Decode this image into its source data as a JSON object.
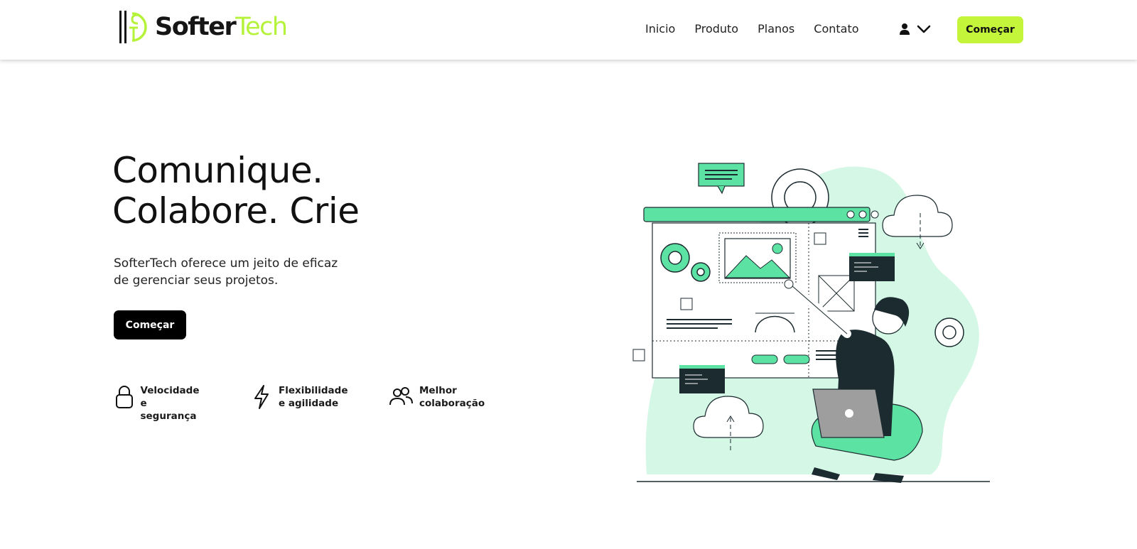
{
  "brand": {
    "name_part1": "Softer",
    "name_part2": "Tech",
    "accent_color": "#b5f23a",
    "illustration_green": "#5ce3a4"
  },
  "nav": {
    "items": [
      {
        "label": "Inicio"
      },
      {
        "label": "Produto"
      },
      {
        "label": "Planos"
      },
      {
        "label": "Contato"
      }
    ],
    "user_icon": "user-icon",
    "dropdown_icon": "chevron-down-icon",
    "cta_label": "Começar"
  },
  "hero": {
    "title_line1": "Comunique.",
    "title_line2": "Colabore. Crie",
    "subtitle_line1": "SofterTech oferece um jeito de eficaz",
    "subtitle_line2": "de gerenciar seus projetos.",
    "cta_label": "Começar"
  },
  "features": [
    {
      "icon": "lock-icon",
      "line1": "Velocidade",
      "line2": "e segurança"
    },
    {
      "icon": "lightning-icon",
      "line1": "Flexibilidade",
      "line2": "e agilidade"
    },
    {
      "icon": "users-icon",
      "line1": "Melhor",
      "line2": "colaboração"
    }
  ]
}
